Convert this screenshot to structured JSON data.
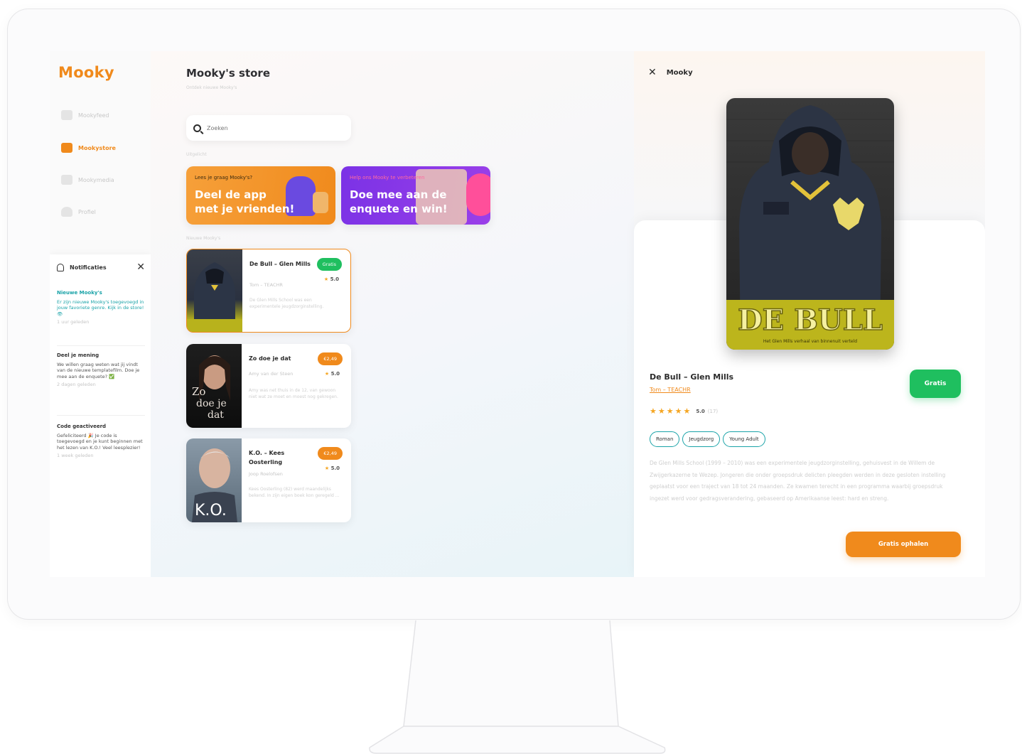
{
  "app": {
    "logo": "Mooky",
    "page_title": "Mooky's store",
    "page_subtitle": "Ontdek nieuwe Mooky's"
  },
  "sidebar": {
    "items": [
      {
        "label": "Mookyfeed",
        "icon": "feed-icon",
        "active": false
      },
      {
        "label": "Mookystore",
        "icon": "store-icon",
        "active": true
      },
      {
        "label": "Mookymedia",
        "icon": "media-icon",
        "active": false
      },
      {
        "label": "Profiel",
        "icon": "profile-icon",
        "active": false
      }
    ]
  },
  "notifications": {
    "title": "Notificaties",
    "items": [
      {
        "title": "Nieuwe Mooky's",
        "body": "Er zijn nieuwe Mooky's toegevoegd in jouw favoriete genre. Kijk in de store! 👁",
        "time": "1 uur geleden"
      },
      {
        "title": "Deel je mening",
        "body": "We willen graag weten wat jij vindt van de nieuwe templatefilm. Doe je mee aan de enquete? ✅",
        "time": "2 dagen geleden"
      },
      {
        "title": "Code geactiveerd",
        "body": "Gefeliciteerd 🎉 Je code is toegevoegd en je kunt beginnen met het lezen van K.O.! Veel leesplezier!",
        "time": "1 week geleden"
      }
    ]
  },
  "search": {
    "placeholder": "Zoeken"
  },
  "sections": {
    "uitgelicht": "Uitgelicht",
    "nieuwe": "Nieuwe Mooky's"
  },
  "banners": [
    {
      "small": "Lees je graag Mooky's?",
      "big_1": "Deel de app",
      "big_2": "met je vrienden!"
    },
    {
      "small": "Help ons Mooky te verbeteren",
      "big_1": "Doe mee aan de",
      "big_2": "enquete en win!"
    }
  ],
  "books": [
    {
      "title": "De Bull – Glen Mills",
      "author": "Tom – TEACHR",
      "badge": "Gratis",
      "badge_color": "green",
      "rating": "5.0",
      "desc": "De Glen Mills School was een experimentele jeugdzorginstelling.",
      "cover_text": "DE BULL"
    },
    {
      "title": "Zo doe je dat",
      "author": "Amy van der Steen",
      "badge": "€2,49",
      "badge_color": "orange",
      "rating": "5.0",
      "desc": "Amy was net thuis in de 12, van gewoon niet wat ze moet en moest nog gekregen.",
      "cover_text": "Zo doe je dat"
    },
    {
      "title": "K.O. – Kees Oosterling",
      "author": "Joop Roelofsen",
      "badge": "€2,49",
      "badge_color": "orange",
      "rating": "5.0",
      "desc": "Kees Oosterling (82) werd maandelijks bekend. In zijn eigen boek kon geregeld ...",
      "cover_text": "K.O."
    }
  ],
  "detail": {
    "header": "Mooky",
    "title": "De Bull – Glen Mills",
    "author": "Tom – TEACHR",
    "rating": "5.0",
    "rating_count": "(17)",
    "price_button": "Gratis",
    "tags": [
      "Roman",
      "Jeugdzorg",
      "Young Adult"
    ],
    "description": "De Glen Mills School (1999 – 2010) was een experimentele jeugdzorginstelling, gehuisvest in de Willem de Zwijgerkazerne te Wezep. Jongeren die onder groepsdruk delicten pleegden werden in deze gesloten instelling geplaatst voor een traject van 18 tot 24 maanden. Ze kwamen terecht in een programma waarbij groepsdruk ingezet werd voor gedragsverandering, gebaseerd op Amerikaanse leest: hard en streng.",
    "cta": "Gratis ophalen",
    "cover_title": "DE BULL",
    "cover_subtitle": "Het Glen Mills verhaal van binnenuit verteld"
  },
  "colors": {
    "accent": "#f08a1c",
    "green": "#1fbf5f",
    "teal": "#1aa3a8",
    "purple": "#7b32e6"
  }
}
